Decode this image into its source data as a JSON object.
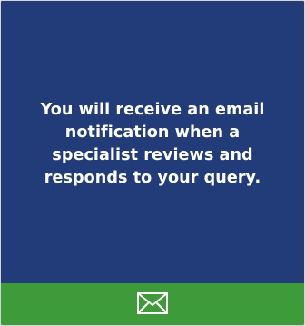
{
  "notification": {
    "message": "You will receive an email notification when a specialist reviews and responds to your query."
  },
  "footer": {
    "icon": "envelope-icon"
  },
  "colors": {
    "panel_background": "#213c79",
    "footer_background": "#3e9b3a",
    "text": "#ffffff"
  }
}
